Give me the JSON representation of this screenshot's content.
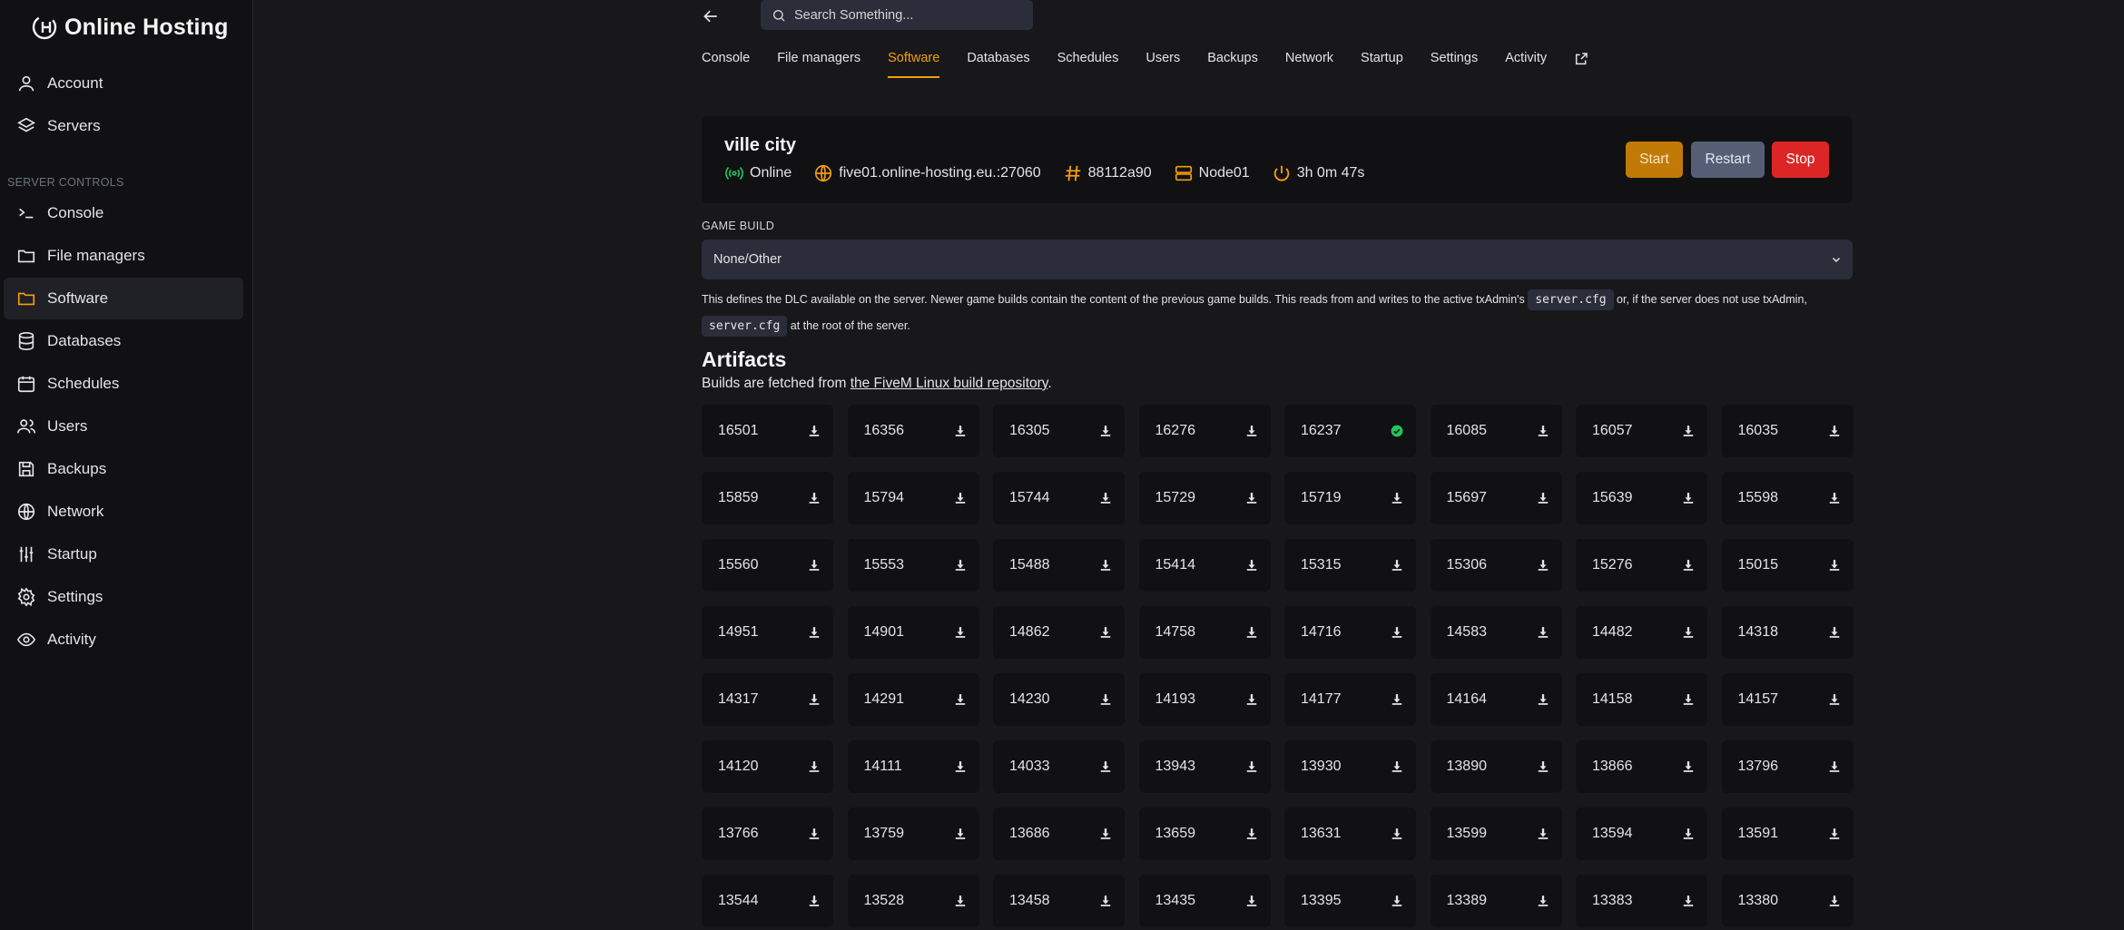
{
  "brand": {
    "name": "Online Hosting",
    "logo_text": "OH"
  },
  "sidebar": {
    "top_items": [
      {
        "label": "Account",
        "icon": "user-icon"
      },
      {
        "label": "Servers",
        "icon": "layers-icon"
      }
    ],
    "section_label": "SERVER CONTROLS",
    "items": [
      {
        "label": "Console",
        "icon": "terminal-icon"
      },
      {
        "label": "File managers",
        "icon": "folder-icon"
      },
      {
        "label": "Software",
        "icon": "folder-icon",
        "active": true
      },
      {
        "label": "Databases",
        "icon": "database-icon"
      },
      {
        "label": "Schedules",
        "icon": "calendar-icon"
      },
      {
        "label": "Users",
        "icon": "users-icon"
      },
      {
        "label": "Backups",
        "icon": "save-icon"
      },
      {
        "label": "Network",
        "icon": "globe-icon"
      },
      {
        "label": "Startup",
        "icon": "sliders-icon"
      },
      {
        "label": "Settings",
        "icon": "gear-icon"
      },
      {
        "label": "Activity",
        "icon": "eye-icon"
      }
    ]
  },
  "search": {
    "placeholder": "Search Something..."
  },
  "tabs": [
    "Console",
    "File managers",
    "Software",
    "Databases",
    "Schedules",
    "Users",
    "Backups",
    "Network",
    "Startup",
    "Settings",
    "Activity"
  ],
  "active_tab": "Software",
  "server": {
    "name": "ville city",
    "status": "Online",
    "address": "five01.online-hosting.eu.:27060",
    "id": "88112a90",
    "node": "Node01",
    "uptime": "3h 0m 47s"
  },
  "controls": {
    "start": "Start",
    "restart": "Restart",
    "stop": "Stop"
  },
  "game_build": {
    "label": "GAME BUILD",
    "value": "None/Other",
    "desc_1": "This defines the DLC available on the server. Newer game builds contain the content of the previous game builds. This reads from and writes to the active txAdmin's",
    "code": "server.cfg",
    "desc_2": "or, if the server does not use txAdmin,",
    "desc_3": "at the root of the server."
  },
  "artifacts": {
    "title": "Artifacts",
    "sub_prefix": "Builds are fetched from",
    "sub_link": "the FiveM Linux build repository",
    "sub_suffix": ".",
    "installed": "16237",
    "builds": [
      "16501",
      "16356",
      "16305",
      "16276",
      "16237",
      "16085",
      "16057",
      "16035",
      "15859",
      "15794",
      "15744",
      "15729",
      "15719",
      "15697",
      "15639",
      "15598",
      "15560",
      "15553",
      "15488",
      "15414",
      "15315",
      "15306",
      "15276",
      "15015",
      "14951",
      "14901",
      "14862",
      "14758",
      "14716",
      "14583",
      "14482",
      "14318",
      "14317",
      "14291",
      "14230",
      "14193",
      "14177",
      "14164",
      "14158",
      "14157",
      "14120",
      "14111",
      "14033",
      "13943",
      "13930",
      "13890",
      "13866",
      "13796",
      "13766",
      "13759",
      "13686",
      "13659",
      "13631",
      "13599",
      "13594",
      "13591",
      "13544",
      "13528",
      "13458",
      "13435",
      "13395",
      "13389",
      "13383",
      "13380"
    ]
  },
  "colors": {
    "accent": "#f59e0b",
    "online": "#22c55e",
    "stop": "#dc2626",
    "start": "#c27a06",
    "restart": "#565e76"
  }
}
